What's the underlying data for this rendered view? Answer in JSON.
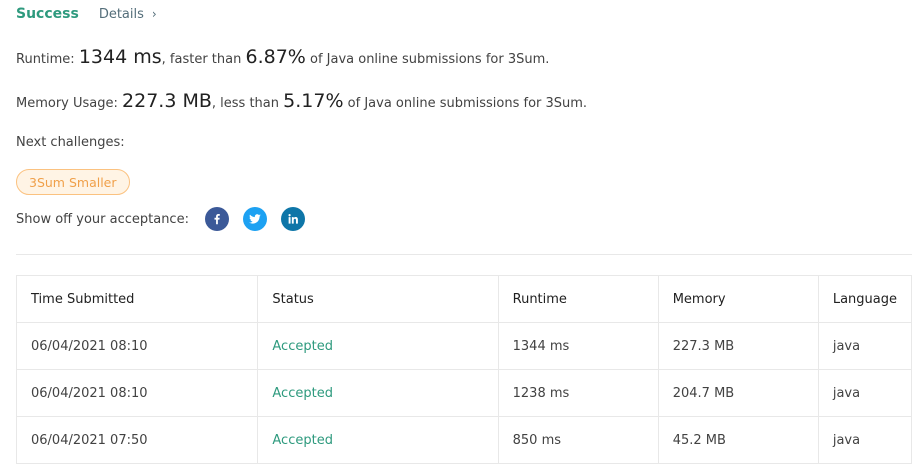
{
  "header": {
    "status": "Success",
    "details_label": "Details",
    "chevron": "›"
  },
  "runtime": {
    "label": "Runtime:",
    "value": "1344 ms",
    "mid": ", faster than",
    "percent": "6.87%",
    "suffix": "of Java online submissions for 3Sum."
  },
  "memory": {
    "label": "Memory Usage:",
    "value": "227.3 MB",
    "mid": ", less than",
    "percent": "5.17%",
    "suffix": "of Java online submissions for 3Sum."
  },
  "next_challenges": {
    "label": "Next challenges:",
    "tag": "3Sum Smaller"
  },
  "share": {
    "label": "Show off your acceptance:",
    "icons": [
      "facebook-icon",
      "twitter-icon",
      "linkedin-icon"
    ]
  },
  "table": {
    "headers": [
      "Time Submitted",
      "Status",
      "Runtime",
      "Memory",
      "Language"
    ],
    "rows": [
      [
        "06/04/2021 08:10",
        "Accepted",
        "1344 ms",
        "227.3 MB",
        "java"
      ],
      [
        "06/04/2021 08:10",
        "Accepted",
        "1238 ms",
        "204.7 MB",
        "java"
      ],
      [
        "06/04/2021 07:50",
        "Accepted",
        "850 ms",
        "45.2 MB",
        "java"
      ]
    ]
  },
  "colors": {
    "accent": "#2e9a7e",
    "tag_border": "#fbc280",
    "tag_text": "#f0a04a"
  }
}
